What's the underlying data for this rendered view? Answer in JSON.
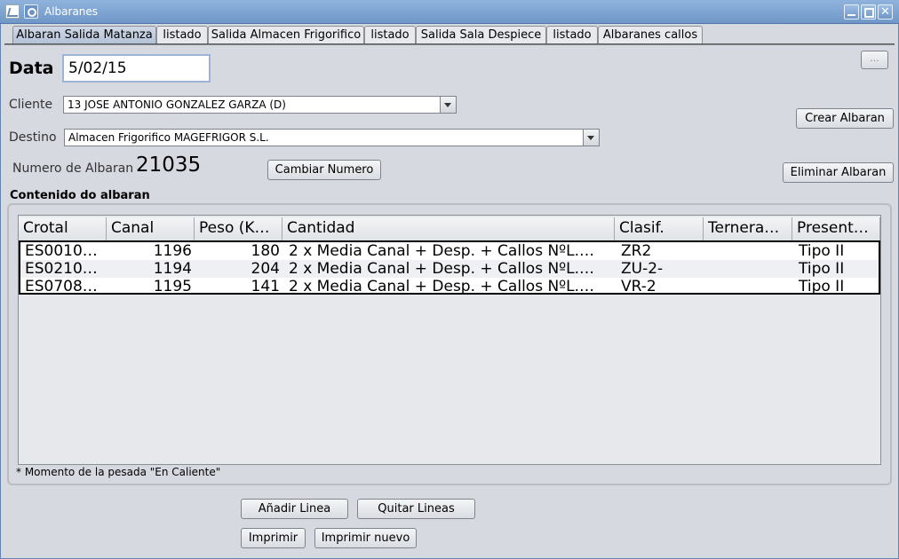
{
  "window": {
    "title": "Albaranes"
  },
  "tabs": [
    "Albaran Salida Matanza",
    "listado",
    "Salida Almacen Frigorifico",
    "listado",
    "Salida Sala Despiece",
    "listado",
    "Albaranes callos"
  ],
  "form": {
    "data_label": "Data",
    "data_value": "5/02/15",
    "cliente_label": "Cliente",
    "cliente_value": "13 JOSE ANTONIO GONZALEZ GARZA (D)",
    "destino_label": "Destino",
    "destino_value": "Almacen Frigorifico MAGEFRIGOR S.L.",
    "numero_label": "Numero de Albaran",
    "numero_value": "21035",
    "cambiar_numero": "Cambiar Numero",
    "small_button": "...",
    "crear_albaran": "Crear Albaran",
    "eliminar_albaran": "Eliminar Albaran"
  },
  "content": {
    "group_title": "Contenido do albaran",
    "columns": [
      "Crotal",
      "Canal",
      "Peso (K…",
      "Cantidad",
      "Clasif.",
      "Ternera…",
      "Present…"
    ],
    "rows": [
      [
        "ES0010…",
        "1196",
        "180",
        "2 x Media Canal + Desp. + Callos NºL.…",
        "ZR2",
        "",
        "Tipo II"
      ],
      [
        "ES0210…",
        "1194",
        "204",
        "2 x Media Canal + Desp. + Callos NºL.…",
        "ZU-2-",
        "",
        "Tipo II"
      ],
      [
        "ES0708…",
        "1195",
        "141",
        "2 x Media Canal + Desp. + Callos NºL.…",
        "VR-2",
        "",
        "Tipo II"
      ]
    ],
    "footnote": "* Momento de la pesada \"En Caliente\""
  },
  "actions": {
    "anadir_linea": "Añadir Linea",
    "quitar_lineas": "Quitar Lineas",
    "imprimir": "Imprimir",
    "imprimir_nuevo": "Imprimir nuevo"
  }
}
